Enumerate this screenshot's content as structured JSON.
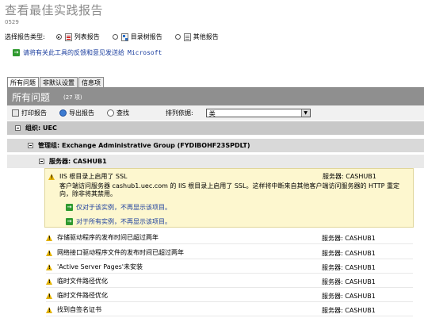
{
  "page": {
    "title": "查看最佳实践报告",
    "id": "0529",
    "report_type_label": "选择报告类型:",
    "report_types": [
      {
        "label": "列表报告",
        "selected": true,
        "icon": "list-report-icon"
      },
      {
        "label": "目录树报告",
        "selected": false,
        "icon": "tree-report-icon"
      },
      {
        "label": "其他报告",
        "selected": false,
        "icon": "other-report-icon"
      }
    ],
    "feedback_prefix": "请将有关此工具的反馈和意见发送给",
    "feedback_target": "Microsoft"
  },
  "tabs": [
    {
      "label": "所有问题",
      "active": true
    },
    {
      "label": "非默认设置",
      "active": false
    },
    {
      "label": "信息项",
      "active": false
    }
  ],
  "issues_header": {
    "title": "所有问题",
    "count": "(27 项)"
  },
  "toolbar": {
    "print": "打印报告",
    "export": "导出报告",
    "find": "查找",
    "sort_label": "排列依据:",
    "sort_value": "类"
  },
  "groups": {
    "org": "组织: UEC",
    "admin_group": "管理组: Exchange Administrative Group (FYDIBOHF23SPDLT)",
    "server": "服务器: CASHUB1"
  },
  "detail": {
    "title": "IIS 根目录上启用了 SSL",
    "server": "服务器: CASHUB1",
    "description": "客户端访问服务器 cashub1.uec.com 的 IIS 根目录上启用了 SSL。这样将中断来自其他客户端访问服务器的 HTTP 重定向，除非将其禁用。",
    "action1": "仅对于该实例，不再显示该项目。",
    "action2": "对于所有实例，不再显示该项目。"
  },
  "rows": [
    {
      "title": "存储驱动程序的发布时间已超过两年",
      "server": "服务器: CASHUB1"
    },
    {
      "title": "网络接口驱动程序文件的发布时间已超过两年",
      "server": "服务器: CASHUB1"
    },
    {
      "title": "'Active Server Pages'未安装",
      "server": "服务器: CASHUB1"
    },
    {
      "title": "临时文件路径优化",
      "server": "服务器: CASHUB1"
    },
    {
      "title": "临时文件路径优化",
      "server": "服务器: CASHUB1"
    },
    {
      "title": "找到自签名证书",
      "server": "服务器: CASHUB1"
    }
  ]
}
